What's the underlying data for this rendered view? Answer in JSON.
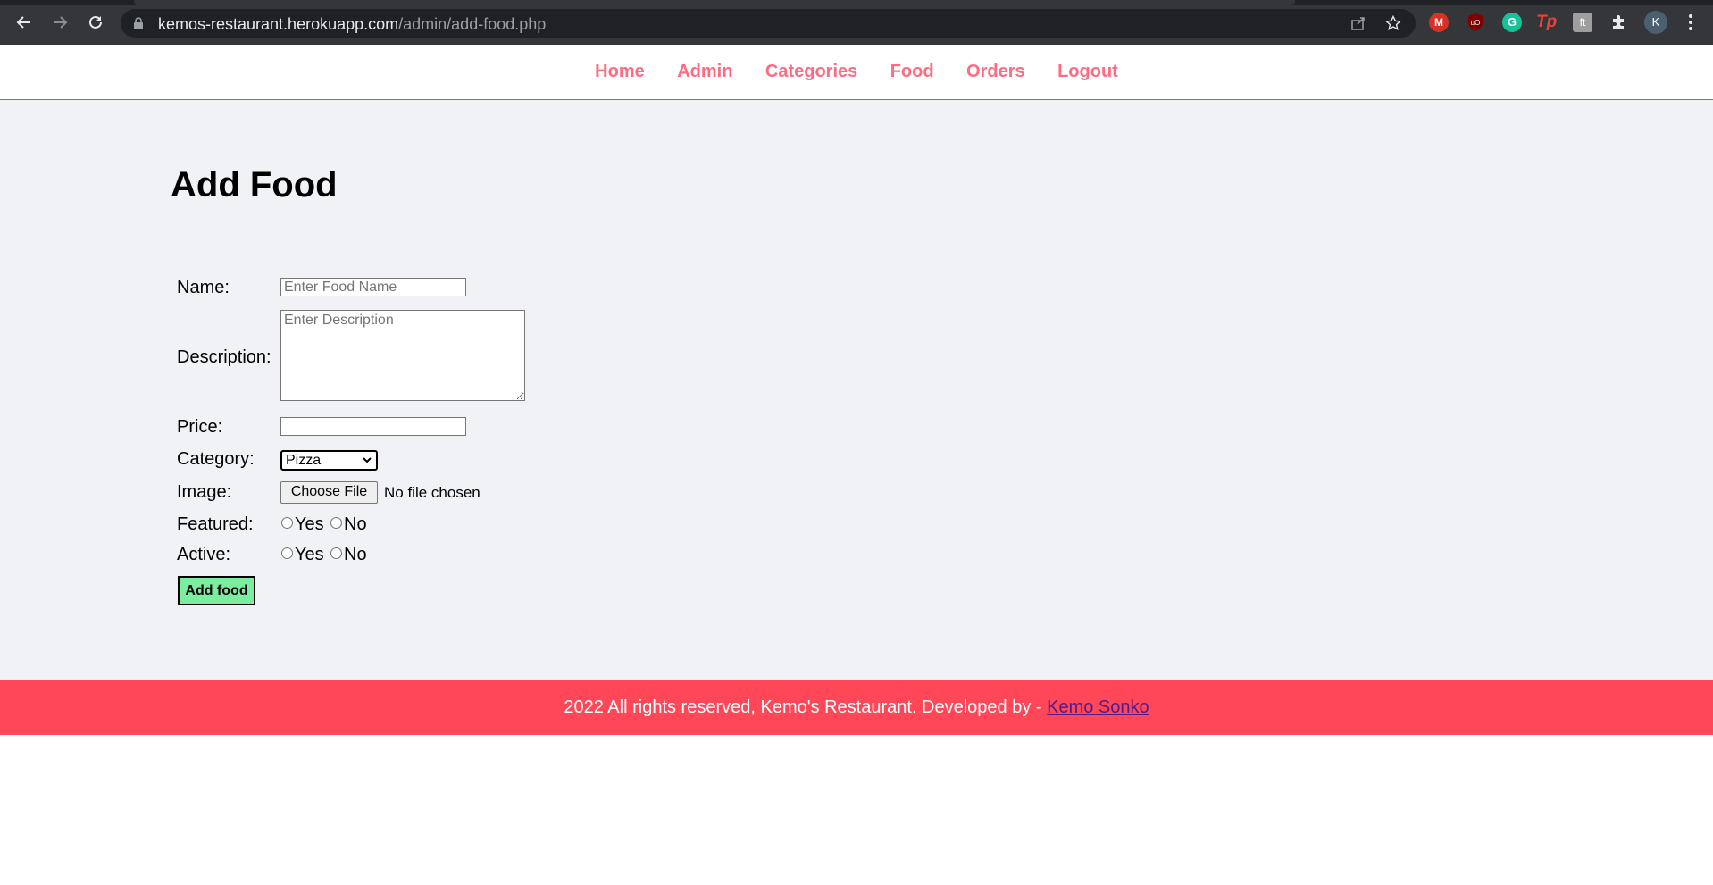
{
  "browser": {
    "url_host": "kemos-restaurant.herokuapp.com",
    "url_path": "/admin/add-food.php",
    "extensions": {
      "gmail": "M",
      "grammarly": "G",
      "tp": "Tp",
      "avatar": "K"
    }
  },
  "nav": {
    "items": [
      "Home",
      "Admin",
      "Categories",
      "Food",
      "Orders",
      "Logout"
    ],
    "color": "#ff6b81"
  },
  "form": {
    "title": "Add Food",
    "name_label": "Name:",
    "name_placeholder": "Enter Food Name",
    "description_label": "Description:",
    "description_placeholder": "Enter Description",
    "price_label": "Price:",
    "price_value": "",
    "category_label": "Category:",
    "category_selected": "Pizza",
    "image_label": "Image:",
    "choose_file_label": "Choose File",
    "file_status": "No file chosen",
    "featured_label": "Featured:",
    "active_label": "Active:",
    "yes_label": "Yes",
    "no_label": "No",
    "submit_label": "Add food",
    "submit_color": "#7bed9f"
  },
  "footer": {
    "text": "2022 All rights reserved, Kemo's Restaurant. Developed by - ",
    "link_text": "Kemo Sonko",
    "color": "#ff4757"
  }
}
